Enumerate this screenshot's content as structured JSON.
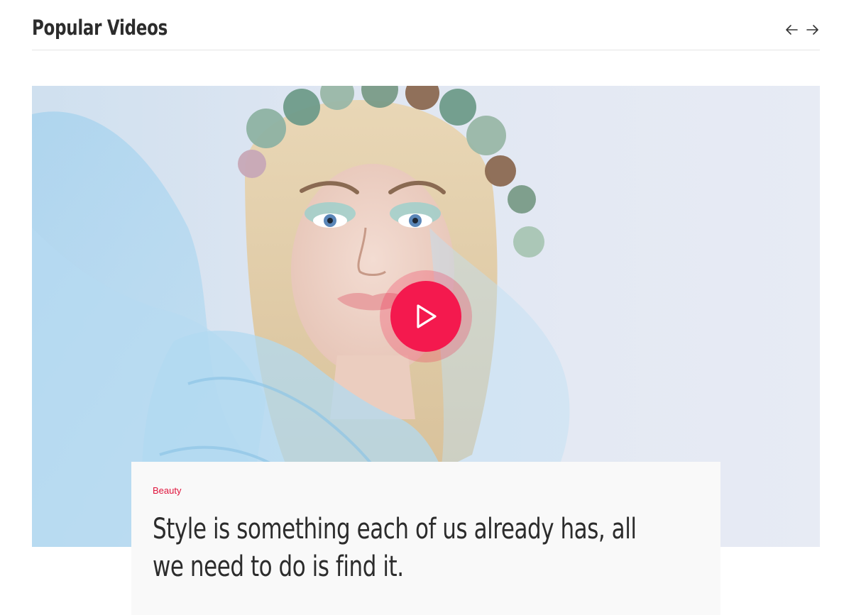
{
  "section": {
    "title": "Popular Videos"
  },
  "nav": {
    "prev_icon": "arrow-left-icon",
    "next_icon": "arrow-right-icon"
  },
  "video": {
    "play_icon": "play-icon",
    "category": "Beauty",
    "title": "Style is something each of us already has, all we need to do is find it."
  },
  "colors": {
    "accent": "#f4194e",
    "category_text": "#e0143c",
    "title_text": "#2c2c2c",
    "card_bg": "#f9f9f9",
    "divider": "#e5e5e5"
  }
}
